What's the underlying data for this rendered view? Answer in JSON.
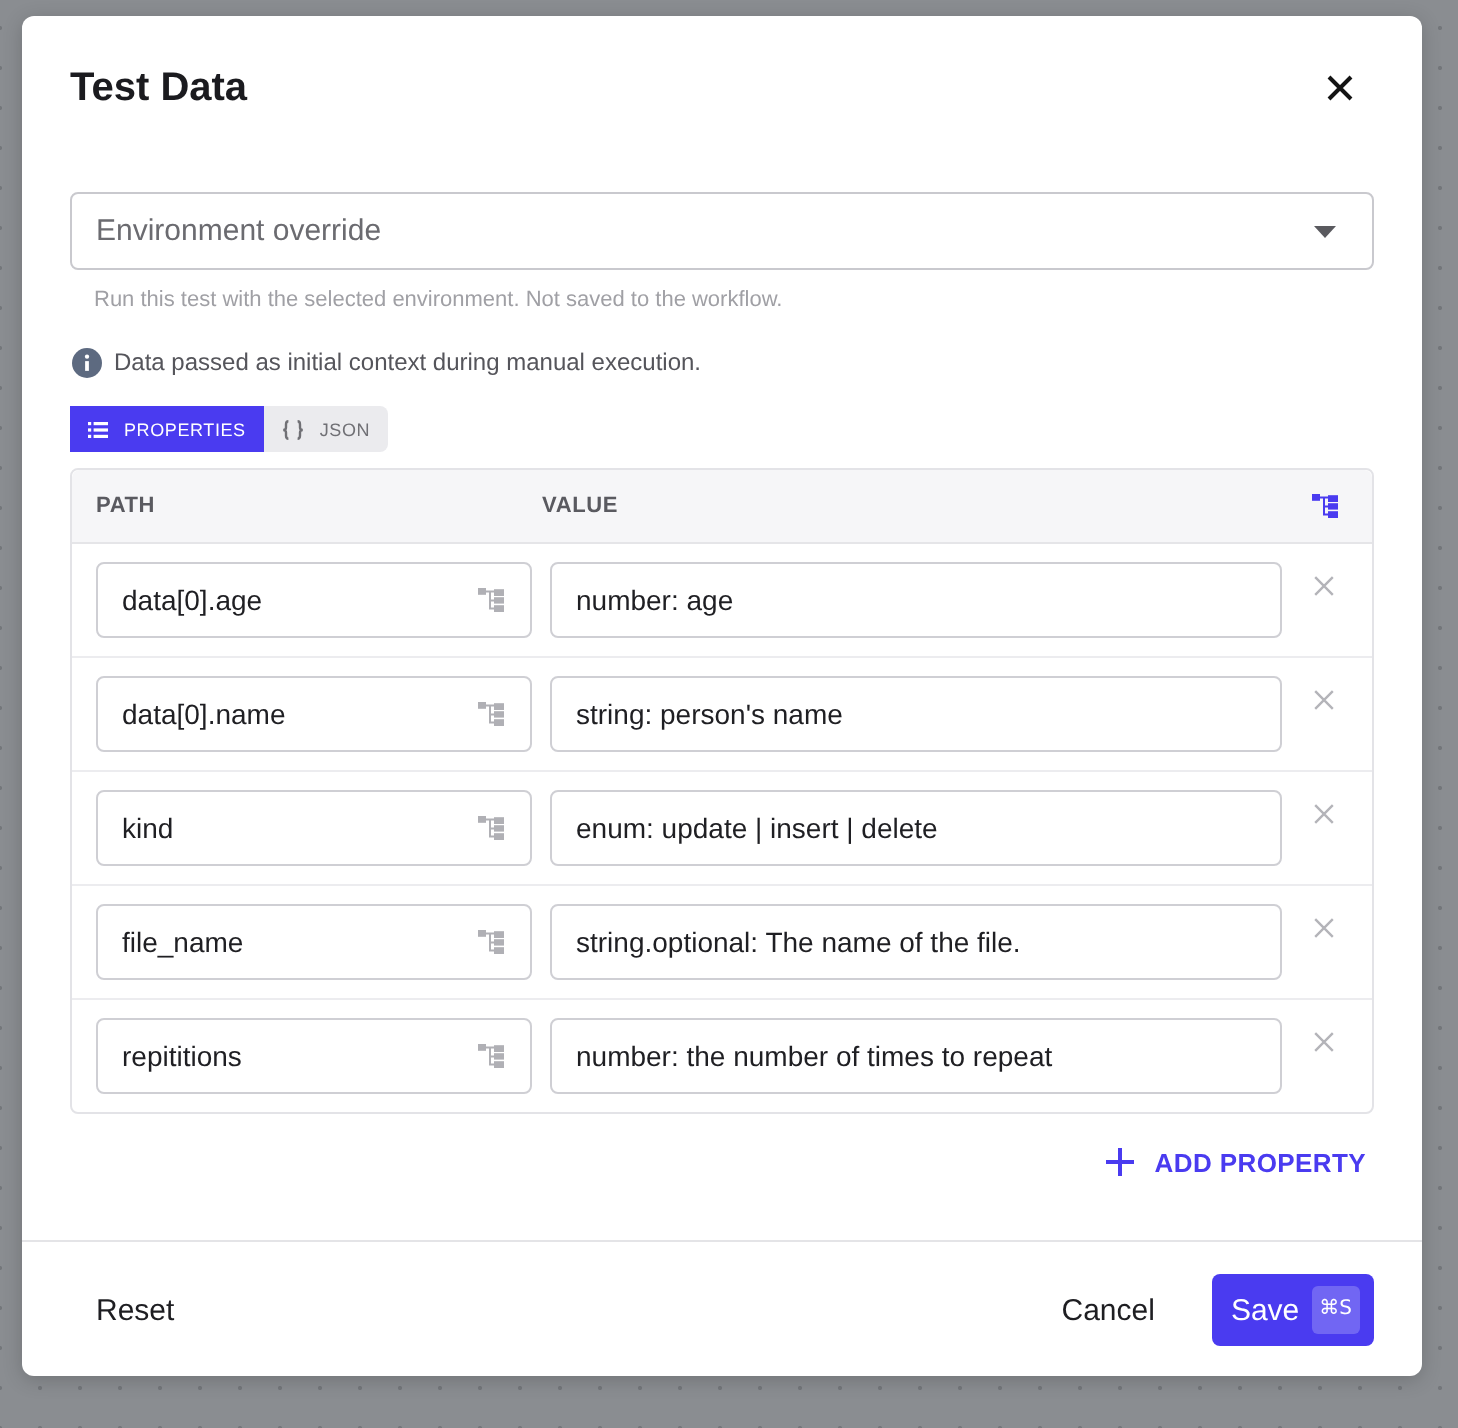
{
  "dialog": {
    "title": "Test Data"
  },
  "environment_select": {
    "placeholder": "Environment override",
    "helper_text": "Run this test with the selected environment. Not saved to the workflow."
  },
  "info_text": "Data passed as initial context during manual execution.",
  "view_tabs": [
    {
      "label": "PROPERTIES",
      "selected": true
    },
    {
      "label": "JSON",
      "selected": false
    }
  ],
  "table": {
    "columns": [
      "PATH",
      "VALUE"
    ],
    "rows": [
      {
        "path": "data[0].age",
        "value": "number: age"
      },
      {
        "path": "data[0].name",
        "value": "string: person's name"
      },
      {
        "path": "kind",
        "value": "enum: update | insert | delete"
      },
      {
        "path": "file_name",
        "value": "string.optional: The name of the file."
      },
      {
        "path": "repititions",
        "value": "number: the number of times to repeat"
      }
    ]
  },
  "add_property": {
    "label": "ADD PROPERTY"
  },
  "footer": {
    "reset": "Reset",
    "cancel": "Cancel",
    "save": "Save",
    "save_shortcut": "⌘S"
  }
}
